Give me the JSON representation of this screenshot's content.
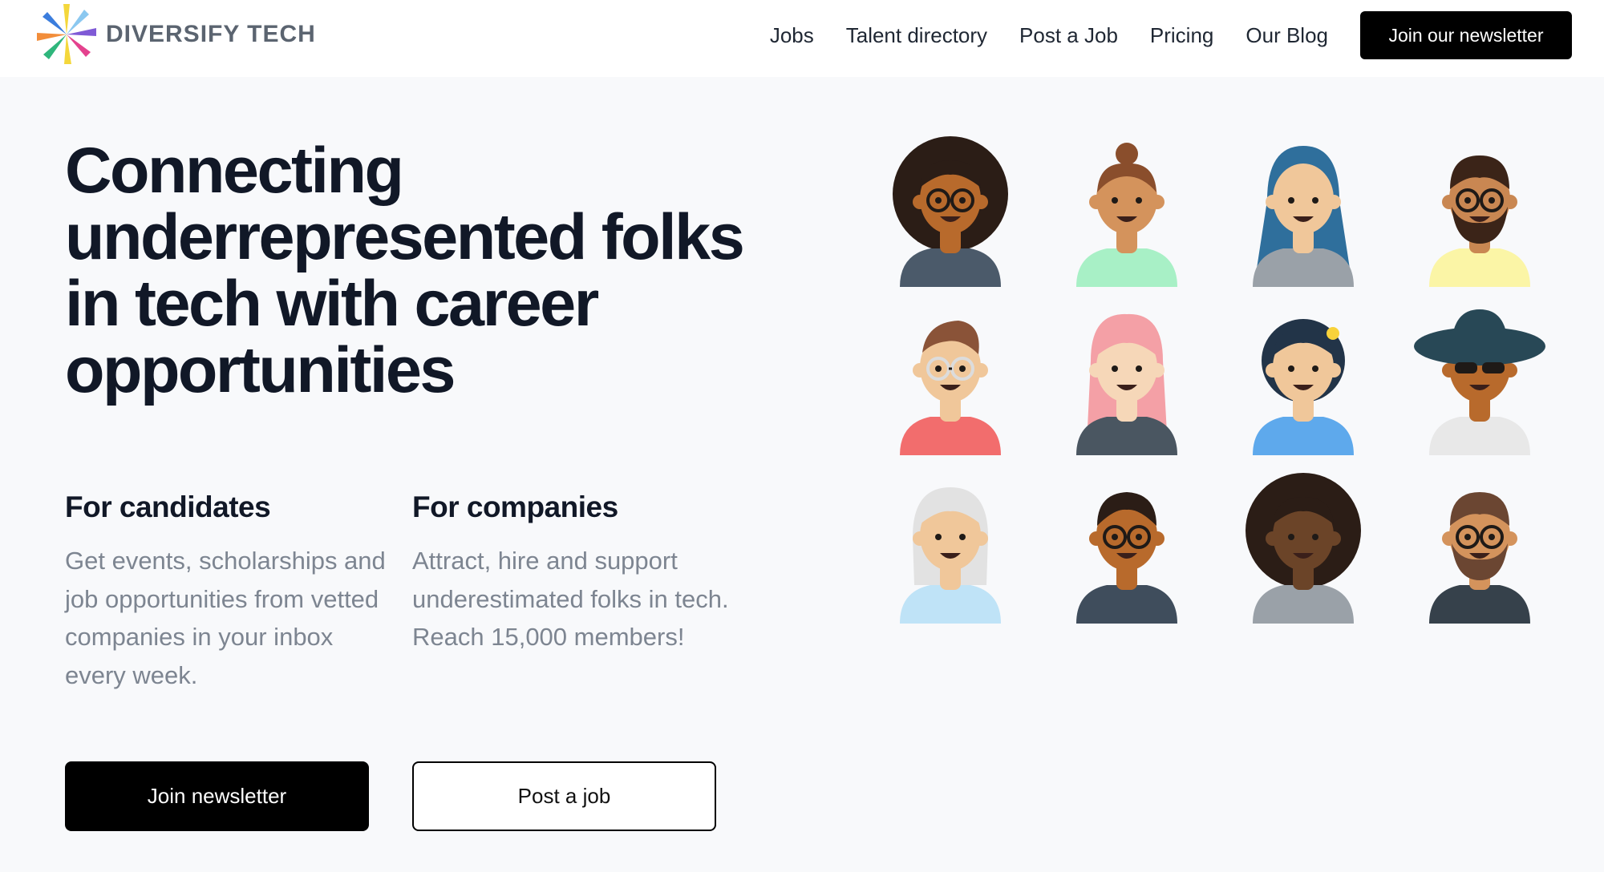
{
  "brand": {
    "name": "DIVERSIFY TECH"
  },
  "nav": {
    "links": [
      "Jobs",
      "Talent directory",
      "Post a Job",
      "Pricing",
      "Our Blog"
    ],
    "cta": "Join our newsletter"
  },
  "hero": {
    "title": "Connecting underrepresented folks in tech with career opportunities"
  },
  "candidates": {
    "heading": "For candidates",
    "text": "Get events, scholarships and job opportunities from vetted companies in your inbox every week."
  },
  "companies": {
    "heading": "For companies",
    "text": "Attract, hire and support underestimated folks in tech. Reach 15,000 members!"
  },
  "buttons": {
    "primary": "Join newsletter",
    "secondary": "Post a job"
  },
  "colors": {
    "text": "#111827",
    "muted": "#7d8591",
    "button": "#000000",
    "background": "#f8f9fb"
  },
  "avatars": [
    {
      "name": "avatar-afro-glasses-woman",
      "skin": "#b86a2c",
      "hair": "#2b1d16",
      "shirt": "#4b5a6a",
      "style": "afro"
    },
    {
      "name": "avatar-bun-woman",
      "skin": "#d4935c",
      "hair": "#8a4e2c",
      "shirt": "#a8f0c6",
      "style": "bun"
    },
    {
      "name": "avatar-hijab-woman",
      "skin": "#f0c79a",
      "hair": "#2f6f9c",
      "shirt": "#9aa1a8",
      "style": "hijab"
    },
    {
      "name": "avatar-bearded-glasses-man",
      "skin": "#c98752",
      "hair": "#3b2418",
      "shirt": "#fbf5a6",
      "style": "beard"
    },
    {
      "name": "avatar-quiff-glasses-man",
      "skin": "#f0c79a",
      "hair": "#8a5338",
      "shirt": "#f26d6d",
      "style": "quiff"
    },
    {
      "name": "avatar-pink-hair-woman",
      "skin": "#f6d7b8",
      "hair": "#f4a0a6",
      "shirt": "#4a5661",
      "style": "long"
    },
    {
      "name": "avatar-flower-woman",
      "skin": "#f0c79a",
      "hair": "#223448",
      "shirt": "#5ea9ec",
      "style": "curly"
    },
    {
      "name": "avatar-hat-sunglasses-man",
      "skin": "#b86a2c",
      "hair": "#284856",
      "shirt": "#e8e8e8",
      "style": "hat"
    },
    {
      "name": "avatar-grey-hair-woman",
      "skin": "#f0c79a",
      "hair": "#e2e2e2",
      "shirt": "#bfe3f7",
      "style": "bob"
    },
    {
      "name": "avatar-laughing-glasses-man",
      "skin": "#b86a2c",
      "hair": "#2b1d16",
      "shirt": "#3f4d5c",
      "style": "short"
    },
    {
      "name": "avatar-afro-woman",
      "skin": "#6b4428",
      "hair": "#2b1d16",
      "shirt": "#9aa1a8",
      "style": "afro"
    },
    {
      "name": "avatar-bearded-brown-man",
      "skin": "#d4935c",
      "hair": "#6b4632",
      "shirt": "#36414b",
      "style": "beard2"
    }
  ]
}
